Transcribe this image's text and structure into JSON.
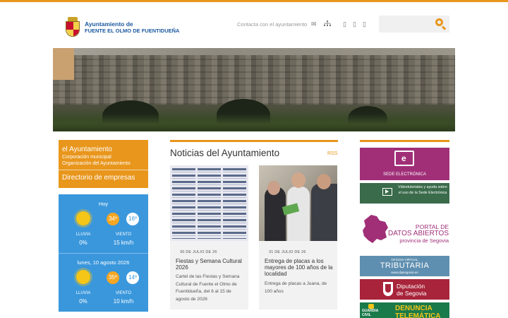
{
  "header": {
    "logo_line1": "Ayuntamiento de",
    "logo_line2": "FUENTE EL OLMO DE FUENTIDUEÑA",
    "contact_link": "Contacta con el ayuntamiento",
    "search_placeholder": ""
  },
  "left_menu": {
    "title": "el Ayuntamiento",
    "items": [
      "Corporación municipal",
      "Organización del Ayuntamiento"
    ],
    "directory": "Directorio de empresas"
  },
  "weather": {
    "days": [
      {
        "label": "Hoy",
        "temp_max": "34º",
        "temp_min": "16º",
        "rain_label": "LLUVIA",
        "rain": "0%",
        "wind_label": "VIENTO",
        "wind": "15 km/h"
      },
      {
        "label": "lunes, 10 agosto 2026",
        "temp_max": "35º",
        "temp_min": "14º",
        "rain_label": "LLUVIA",
        "rain": "0%",
        "wind_label": "VIENTO",
        "wind": "10 km/h"
      }
    ]
  },
  "news": {
    "title": "Noticias del Ayuntamiento",
    "rss": "RSS",
    "items": [
      {
        "date": "30 DE JULIO DE 26",
        "title": "Fiestas y Semana Cultural 2026",
        "text": "Cartel de las Fiestas y Semana Cultural de Fuente el Olmo de Fuentidueña, del 6 al 15 de agosto de 2026"
      },
      {
        "date": "31 DE JULIO DE 26",
        "title": "Entrega de placas a los mayores de 100 años de la localidad",
        "text": "Entrega de placas a Juana, de 100 años"
      }
    ]
  },
  "banners": {
    "sede": "SEDE ELECTRÓNICA",
    "video": "Videotutoriales y ayuda sobre el uso de la Sede Electrónica",
    "portal_l1": "PORTAL DE",
    "portal_l2": "DATOS ABIERTOS",
    "portal_l3": "provincia de Segovia",
    "trib_l1": "OFICINA VIRTUAL",
    "trib_l2": "TRIBUTARIA",
    "trib_l3": "www.dipsegovia.es",
    "dip_l1": "Diputación",
    "dip_l2": "de Segovia",
    "gc_l1": "GUARDIA",
    "gc_l2": "CIVIL",
    "den_l1": "DENUNCIA",
    "den_l2": "TELEMÁTICA"
  },
  "colors": {
    "accent": "#e8961c",
    "weather_bg": "#3a97dc",
    "sede": "#a02f78",
    "video": "#3a6b4a",
    "tributaria": "#5f8fb0",
    "diputacion": "#a8243a",
    "denuncia": "#1a7a4a"
  }
}
